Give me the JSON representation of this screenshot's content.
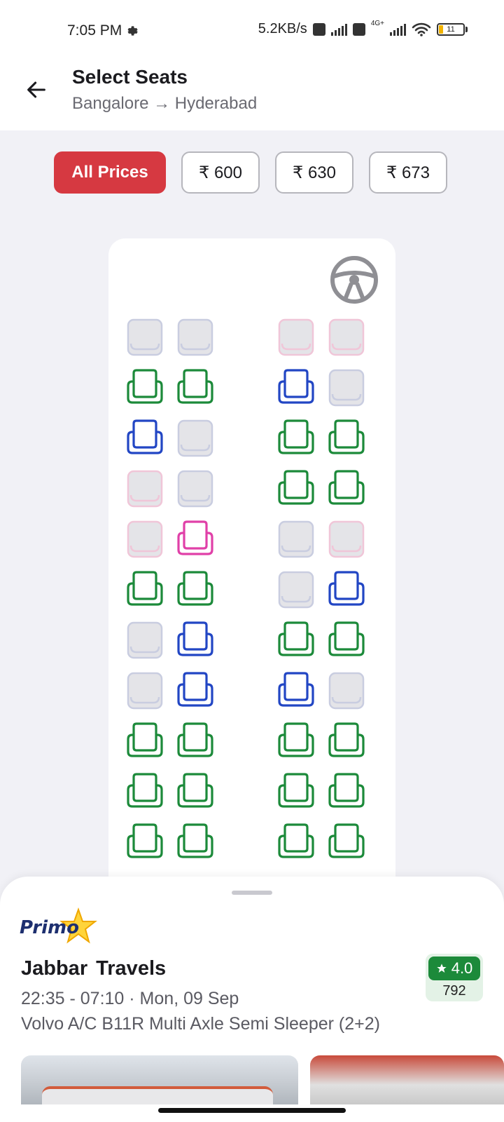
{
  "status_bar": {
    "time": "7:05 PM",
    "network_speed": "5.2KB/s",
    "network_type": "4G+",
    "battery_level": "11",
    "icons": [
      "settings-gear-icon",
      "volte-icon",
      "signal-icon",
      "wifi-icon",
      "battery-icon"
    ]
  },
  "header": {
    "title": "Select Seats",
    "route": "Bangalore → Hyderabad",
    "back_icon": "arrow-left-icon"
  },
  "price_filters": [
    {
      "label": "All Prices",
      "active": true
    },
    {
      "label": "₹ 600",
      "active": false
    },
    {
      "label": "₹ 630",
      "active": false
    },
    {
      "label": "₹ 673",
      "active": false
    }
  ],
  "seat_legend_colors": {
    "available": "#1c8a3a",
    "available_male": "#2246c4",
    "available_female": "#e040a8",
    "booked": "#c9cde0",
    "booked_female": "#f0c6d8"
  },
  "seat_rows": [
    [
      "booked",
      "booked",
      "booked_female",
      "booked_female"
    ],
    [
      "available",
      "available",
      "available_male",
      "booked"
    ],
    [
      "available_male",
      "booked",
      "available",
      "available"
    ],
    [
      "booked_female",
      "booked",
      "available",
      "available"
    ],
    [
      "booked_female",
      "available_female",
      "booked",
      "booked_female"
    ],
    [
      "available",
      "available",
      "booked",
      "available_male"
    ],
    [
      "booked",
      "available_male",
      "available",
      "available"
    ],
    [
      "booked",
      "available_male",
      "available_male",
      "booked"
    ],
    [
      "available",
      "available",
      "available",
      "available"
    ],
    [
      "available",
      "available",
      "available",
      "available"
    ],
    [
      "available",
      "available",
      "available",
      "available"
    ]
  ],
  "bus": {
    "brand": "Primo",
    "operator": "Jabbar  Travels",
    "timing": "22:35 - 07:10 · Mon, 09 Sep",
    "type": "Volvo A/C B11R Multi Axle Semi Sleeper (2+2)",
    "rating": "4.0",
    "rating_count": "792",
    "rating_color": "#1c8a3a"
  }
}
